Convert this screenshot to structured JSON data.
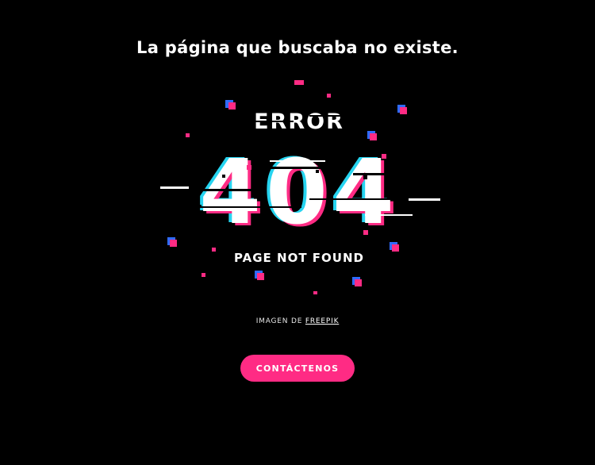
{
  "page": {
    "title": "La página que buscaba no existe."
  },
  "illustration": {
    "error_word": "ERROR",
    "code": "404",
    "message": "PAGE NOT FOUND",
    "colors": {
      "background": "#000000",
      "text": "#ffffff",
      "glitch_pink": "#ff2b84",
      "glitch_blue": "#2f6bff",
      "glitch_cyan": "#26d4f0"
    }
  },
  "credit": {
    "prefix": "IMAGEN DE",
    "link_label": "FREEPIK"
  },
  "cta": {
    "label": "CONTÁCTENOS",
    "color": "#ff2b84"
  }
}
